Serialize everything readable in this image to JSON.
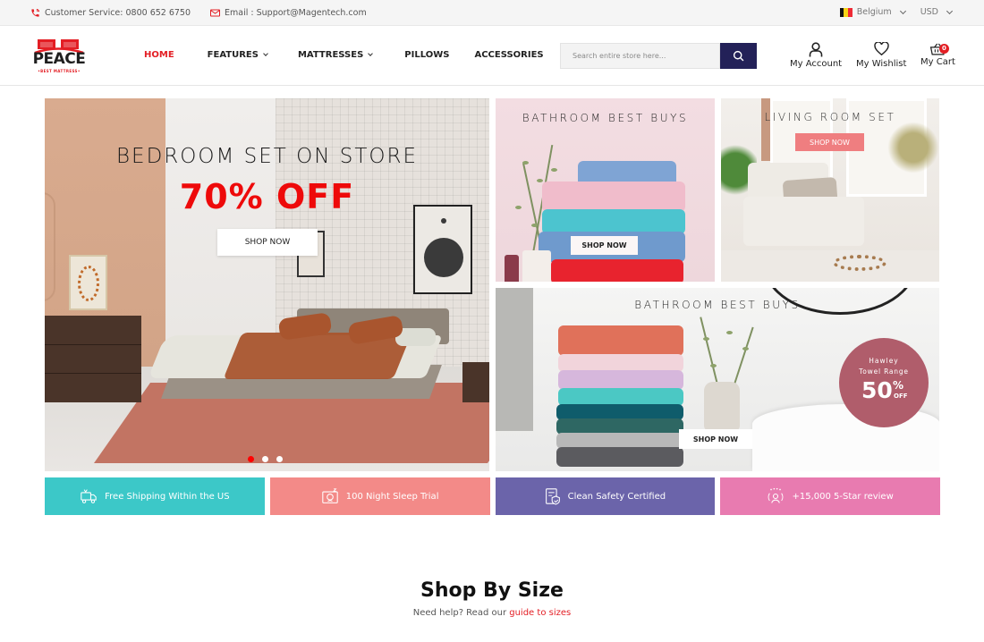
{
  "topbar": {
    "customer_service": "Customer Service: 0800 652 6750",
    "email": "Email : Support@Magentech.com",
    "country": "Belgium",
    "currency": "USD"
  },
  "header": {
    "logo_text": "PEACE",
    "logo_tagline": "•BEST MATTRESS•",
    "nav": [
      {
        "label": "HOME",
        "active": true,
        "has_dropdown": false
      },
      {
        "label": "FEATURES",
        "active": false,
        "has_dropdown": true
      },
      {
        "label": "MATTRESSES",
        "active": false,
        "has_dropdown": true
      },
      {
        "label": "PILLOWS",
        "active": false,
        "has_dropdown": false
      },
      {
        "label": "ACCESSORIES",
        "active": false,
        "has_dropdown": false
      }
    ],
    "search_placeholder": "Search entire store here...",
    "account_label": "My Account",
    "wishlist_label": "My Wishlist",
    "cart_label": "My Cart",
    "cart_count": "0"
  },
  "hero": {
    "title": "BEDROOM SET ON STORE",
    "offer": "70% OFF",
    "button": "SHOP NOW",
    "slides": 3,
    "active_slide": 1
  },
  "banners": [
    {
      "title": "BATHROOM BEST BUYS",
      "button": "SHOP NOW"
    },
    {
      "title": "LIVING ROOM SET",
      "button": "SHOP NOW"
    },
    {
      "title": "BATHROOM BEST BUYS",
      "button": "SHOP NOW",
      "badge": {
        "line1": "Hawley",
        "line2": "Towel Range",
        "percent": "50",
        "sign": "%",
        "suffix": "OFF"
      }
    }
  ],
  "features": [
    {
      "icon": "delivery-truck-icon",
      "label": "Free Shipping Within the US",
      "color": "#3cc8c8"
    },
    {
      "icon": "sleep-icon",
      "label": "100 Night Sleep Trial",
      "color": "#f38a88"
    },
    {
      "icon": "safety-certificate-icon",
      "label": "Clean Safety Certified",
      "color": "#6b64aa"
    },
    {
      "icon": "review-stars-icon",
      "label": "+15,000 5-Star review",
      "color": "#e87bb0"
    }
  ],
  "section": {
    "title": "Shop By Size",
    "subtitle": "Need help? Read our",
    "link": "guide to sizes"
  },
  "colors": {
    "accent": "#e31e24",
    "search_button": "#232158",
    "topbar_bg": "#f5f5f5"
  }
}
